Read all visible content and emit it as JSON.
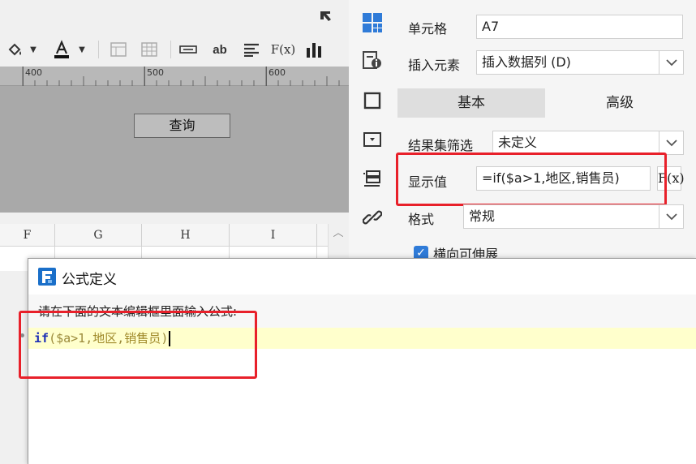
{
  "toolbar": {
    "bold_text_label": "ab",
    "formula_label": "F(x)"
  },
  "ruler": {
    "ticks": [
      "400",
      "500",
      "600"
    ]
  },
  "canvas": {
    "query_button_label": "查询"
  },
  "sheet": {
    "columns": [
      "F",
      "G",
      "H",
      "I"
    ]
  },
  "properties": {
    "cell_label": "单元格",
    "cell_value": "A7",
    "insert_element_label": "插入元素",
    "insert_element_value": "插入数据列 (D)",
    "tabs": [
      {
        "label": "基本",
        "active": true
      },
      {
        "label": "高级",
        "active": false
      }
    ],
    "filter_label": "结果集筛选",
    "filter_value": "未定义",
    "display_value_label": "显示值",
    "display_value": "=if($a>1,地区,销售员)",
    "fx_label": "F(x)",
    "format_label": "格式",
    "format_value": "常规",
    "horizontal_expand_label": "横向可伸展"
  },
  "dialog": {
    "title": "公式定义",
    "instruction": "请在下面的文本编辑框里面输入公式:",
    "code": {
      "keyword": "if",
      "open_paren": "(",
      "variable": "$a>1",
      "sep1": ",",
      "arg1": "地区",
      "sep2": ",",
      "arg2": "销售员",
      "close_paren": ")"
    }
  },
  "colors": {
    "highlight_red": "#e8202a",
    "accent_blue": "#2f7bd8",
    "editor_line": "#ffffcc",
    "keyword_blue": "#1c2fb5"
  }
}
